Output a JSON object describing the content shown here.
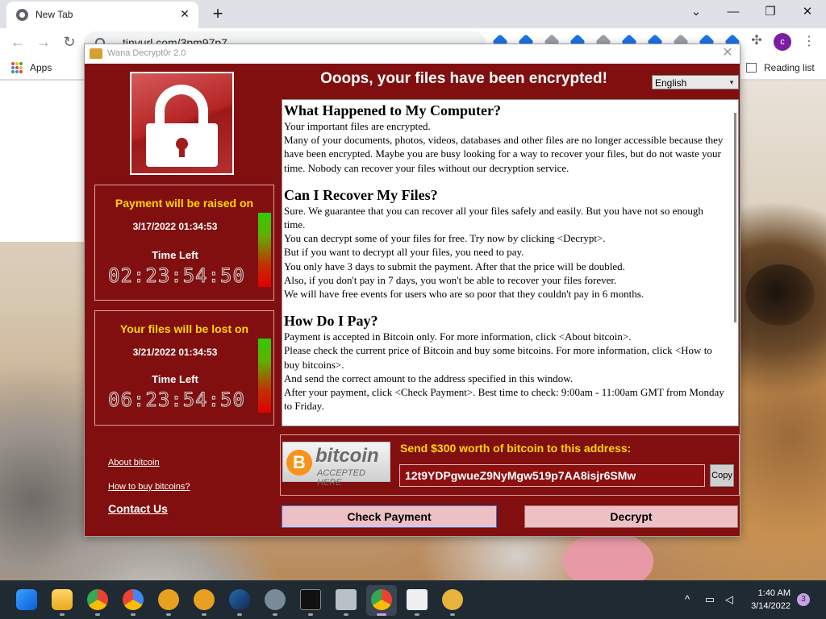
{
  "browser": {
    "tab_title": "New Tab",
    "tab_close": "✕",
    "new_tab": "+",
    "window_controls": {
      "tabs_menu": "⌄",
      "minimize": "—",
      "restore": "❐",
      "close": "✕"
    },
    "nav": {
      "back": "←",
      "forward": "→",
      "reload": "↻"
    },
    "url": "tinyurl.com/3pm97p7",
    "profile_initial": "c",
    "menu": "⋮",
    "bookmarks": {
      "apps_label": "Apps",
      "reading_list_label": "Reading list"
    },
    "extension_icons": [
      "puzzle-icon"
    ]
  },
  "wannacry": {
    "window_title": "Wana Decrypt0r 2.0",
    "close": "✕",
    "heading": "Ooops, your files have been encrypted!",
    "language": "English",
    "language_arrow": "▾",
    "raise_box": {
      "title": "Payment will be raised on",
      "date": "3/17/2022 01:34:53",
      "time_left_label": "Time Left",
      "time_left": "02:23:54:50"
    },
    "lost_box": {
      "title": "Your files will be lost on",
      "date": "3/21/2022 01:34:53",
      "time_left_label": "Time Left",
      "time_left": "06:23:54:50"
    },
    "sections": [
      {
        "heading": "What Happened to My Computer?",
        "paragraphs": [
          "Your important files are encrypted.",
          "Many of your documents, photos, videos, databases and other files are no longer accessible because they have been encrypted. Maybe you are busy looking for a way to recover your files, but do not waste your time. Nobody can recover your files without our decryption service."
        ]
      },
      {
        "heading": "Can I Recover My Files?",
        "paragraphs": [
          "Sure. We guarantee that you can recover all your files safely and easily. But you have not so enough time.",
          "You can decrypt some of your files for free. Try now by clicking <Decrypt>.",
          "But if you want to decrypt all your files, you need to pay.",
          "You only have 3 days to submit the payment. After that the price will be doubled.",
          "Also, if you don't pay in 7 days, you won't be able to recover your files forever.",
          "We will have free events for users who are so poor that they couldn't pay in 6 months."
        ]
      },
      {
        "heading": "How Do I Pay?",
        "paragraphs": [
          "Payment is accepted in Bitcoin only. For more information, click <About bitcoin>.",
          "Please check the current price of Bitcoin and buy some bitcoins. For more information, click <How to buy bitcoins>.",
          "And send the correct amount to the address specified in this window.",
          "After your payment, click <Check Payment>. Best time to check: 9:00am - 11:00am GMT from Monday to Friday."
        ]
      }
    ],
    "links": {
      "about_bitcoin": "About bitcoin",
      "how_to_buy": "How to buy bitcoins?",
      "contact": "Contact Us"
    },
    "bitcoin": {
      "coin_symbol": "B",
      "logo_word": "bitcoin",
      "logo_sub": "ACCEPTED HERE",
      "prompt": "Send $300 worth of bitcoin to this address:",
      "address": "12t9YDPgwueZ9NyMgw519p7AA8isjr6SMw",
      "copy_label": "Copy"
    },
    "buttons": {
      "check_payment": "Check Payment",
      "decrypt": "Decrypt"
    }
  },
  "taskbar": {
    "apps": [
      "start-icon",
      "file-explorer-icon",
      "chrome-icon",
      "chrome-icon",
      "brave-icon",
      "brave-icon",
      "steam-icon",
      "settings-icon",
      "terminal-icon",
      "network-drive-icon",
      "chrome-icon",
      "files-icon",
      "handshake-icon"
    ],
    "tray": {
      "chevron": "^",
      "time": "1:40 AM",
      "date": "3/14/2022",
      "notifications": "3"
    }
  }
}
